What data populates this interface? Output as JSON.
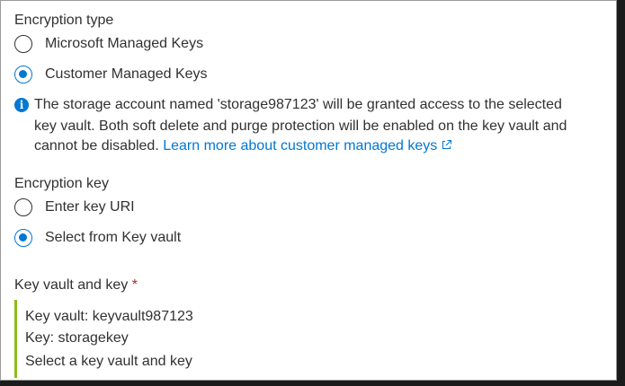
{
  "encryption_type": {
    "label": "Encryption type",
    "options": [
      {
        "label": "Microsoft Managed Keys",
        "selected": false
      },
      {
        "label": "Customer Managed Keys",
        "selected": true
      }
    ]
  },
  "info": {
    "line1": "The storage account named 'storage987123' will be granted access to the selected",
    "line2": "key vault. Both soft delete and purge protection will be enabled on the key vault and",
    "line3": "cannot be disabled.",
    "link_text": "Learn more about customer managed keys",
    "icon": "info-icon"
  },
  "encryption_key": {
    "label": "Encryption key",
    "options": [
      {
        "label": "Enter key URI",
        "selected": false
      },
      {
        "label": "Select from Key vault",
        "selected": true
      }
    ]
  },
  "key_vault": {
    "label": "Key vault and key",
    "required_mark": "*",
    "vault_line": "Key vault: keyvault987123",
    "key_line": "Key: storagekey",
    "select_link": "Select a key vault and key"
  },
  "colors": {
    "accent": "#0078d4",
    "required": "#a4262c",
    "selection_bar": "#8cbd18"
  }
}
